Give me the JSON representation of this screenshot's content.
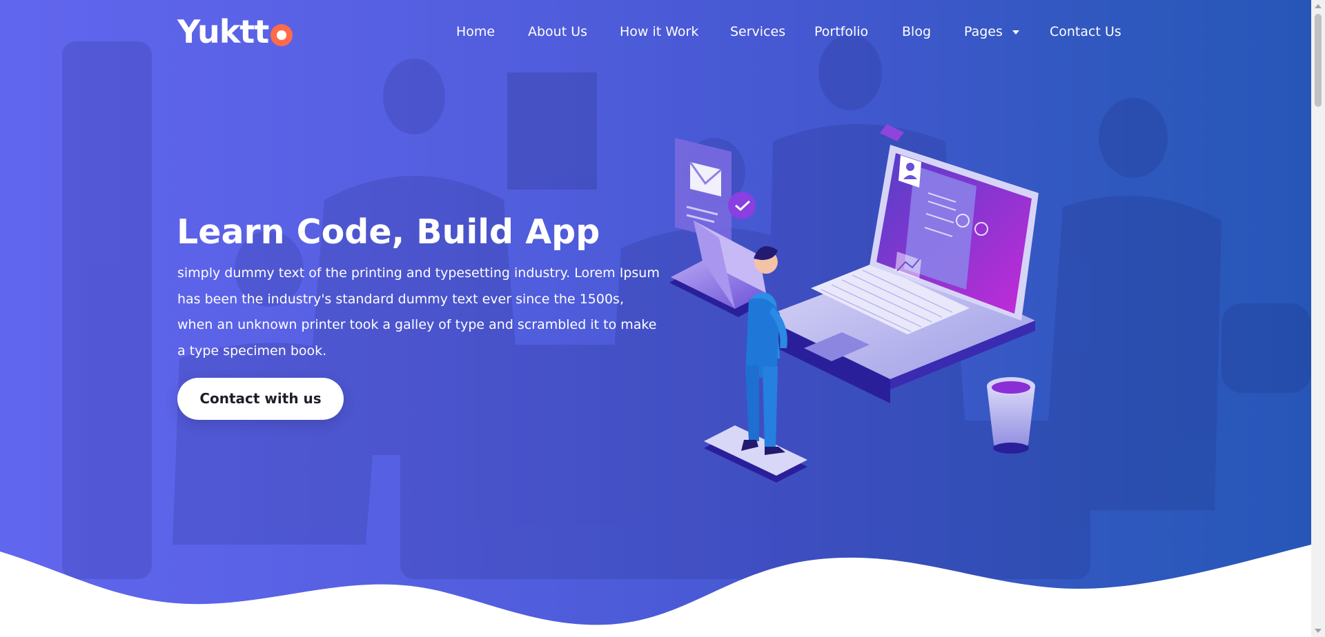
{
  "brand": {
    "name": "Yuktt",
    "accent_color": "#ff6b4a"
  },
  "nav": {
    "items": [
      {
        "label": "Home"
      },
      {
        "label": "About Us"
      },
      {
        "label": "How it Work"
      },
      {
        "label": "Services"
      },
      {
        "label": "Portfolio"
      },
      {
        "label": "Blog"
      },
      {
        "label": "Pages",
        "has_dropdown": true
      },
      {
        "label": "Contact Us"
      }
    ]
  },
  "hero": {
    "title": "Learn Code, Build App",
    "description": "simply dummy text of the printing and typesetting industry. Lorem Ipsum has been the industry's standard dummy text ever since the 1500s, when an unknown printer took a galley of type and scrambled it to make a type specimen book.",
    "cta_label": "Contact with us",
    "overlay_color": "#4f5fdc",
    "illustration_colors": {
      "primary": "#6a4fd8",
      "magenta": "#c428d8",
      "person": "#2c8ee8"
    }
  }
}
